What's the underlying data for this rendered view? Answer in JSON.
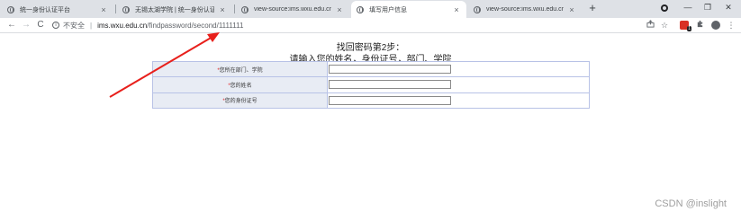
{
  "browser": {
    "tabs": [
      {
        "title": "统一身份认证平台",
        "active": false
      },
      {
        "title": "无锡太湖学院 | 统一身份认证登录",
        "active": false
      },
      {
        "title": "view-source:ims.wxu.edu.cn/fi",
        "active": false
      },
      {
        "title": "填写用户信息",
        "active": true
      },
      {
        "title": "view-source:ims.wxu.edu.cn/fi",
        "active": false
      }
    ],
    "tab_close_glyph": "×",
    "new_tab_glyph": "+",
    "window_controls": {
      "minimize": "—",
      "maximize": "❐",
      "close": "✕"
    },
    "nav": {
      "back": "←",
      "forward": "→",
      "reload": "C"
    },
    "address_bar": {
      "security_label": "不安全",
      "separator": "|",
      "url_host": "ims.wxu.edu.cn",
      "url_path": "/findpassword/second/1111111"
    },
    "toolbar_icons": [
      "share-icon",
      "star-icon",
      "extension-red-icon",
      "puzzle-icon",
      "profile-icon",
      "menu-icon"
    ],
    "extension_badge": "1"
  },
  "page": {
    "title": "找回密码第2步：",
    "subtitle": "请输入您的姓名，身份证号，部门、学院",
    "form": {
      "required_mark": "*",
      "rows": [
        {
          "label": "您所在部门、学院",
          "value": ""
        },
        {
          "label": "您的姓名",
          "value": ""
        },
        {
          "label": "您的身份证号",
          "value": ""
        }
      ]
    }
  },
  "watermark": "CSDN @inslight",
  "colors": {
    "tab_strip": "#dee1e6",
    "form_border": "#9aa8d8",
    "label_bg": "#e8ecf4",
    "required": "#e02020",
    "annotation_arrow": "#e8201c"
  }
}
